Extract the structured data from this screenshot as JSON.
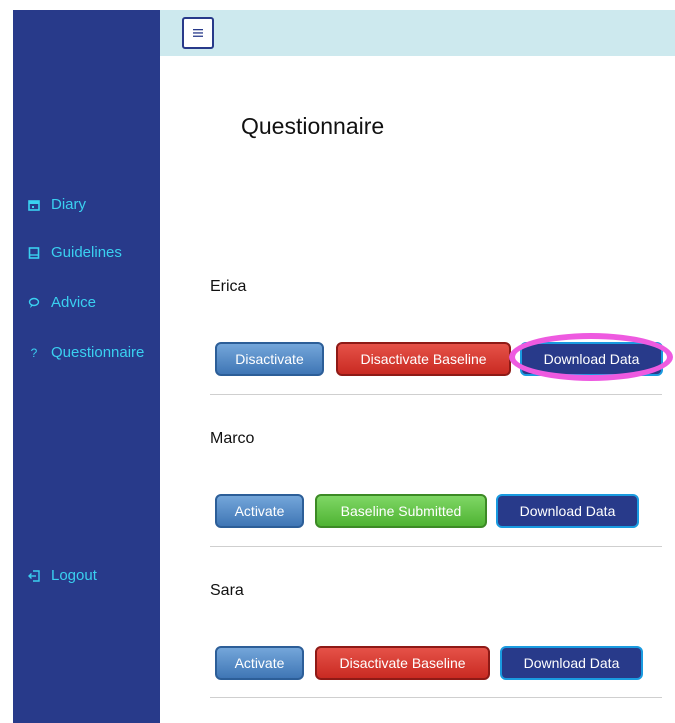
{
  "sidebar": {
    "items": [
      {
        "label": "Diary",
        "icon": "calendar-icon"
      },
      {
        "label": "Guidelines",
        "icon": "book-icon"
      },
      {
        "label": "Advice",
        "icon": "chat-bubble-icon"
      },
      {
        "label": "Questionnaire",
        "icon": "question-icon"
      }
    ],
    "logout_label": "Logout"
  },
  "header": {
    "menu_icon": "menu-icon"
  },
  "page": {
    "title": "Questionnaire"
  },
  "users": [
    {
      "name": "Erica",
      "activation_label": "Disactivate",
      "baseline_label": "Disactivate Baseline",
      "download_label": "Download Data"
    },
    {
      "name": "Marco",
      "activation_label": "Activate",
      "baseline_label": "Baseline Submitted",
      "download_label": "Download Data"
    },
    {
      "name": "Sara",
      "activation_label": "Activate",
      "baseline_label": "Disactivate Baseline",
      "download_label": "Download Data"
    }
  ],
  "colors": {
    "sidebar_bg": "#283a8a",
    "nav_text": "#3ad0f0",
    "topbar_bg": "#cde9ee",
    "highlight": "#ee5ae0"
  }
}
